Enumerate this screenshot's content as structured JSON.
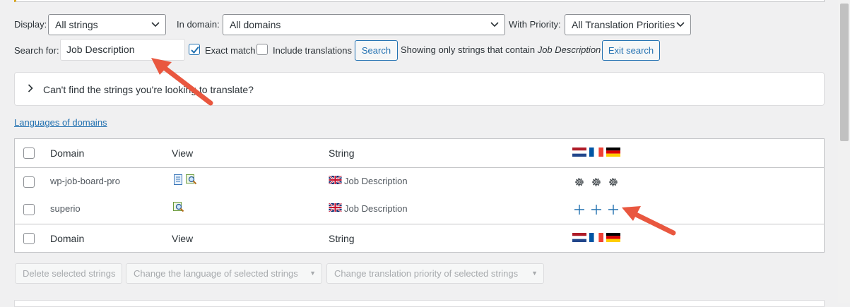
{
  "filters": {
    "display_label": "Display:",
    "display_value": "All strings",
    "domain_label": "In domain:",
    "domain_value": "All domains",
    "priority_label": "With Priority:",
    "priority_value": "All Translation Priorities",
    "search_label": "Search for:",
    "search_value": "Job Description",
    "exact_match_label": "Exact match",
    "exact_match_checked": true,
    "include_translations_label": "Include translations",
    "search_button": "Search",
    "showing_prefix": "Showing only strings that contain",
    "showing_term": "Job Description",
    "exit_search_button": "Exit search"
  },
  "help_panel": {
    "text": "Can't find the strings you're looking to translate?"
  },
  "languages_link": "Languages of domains",
  "table": {
    "columns": [
      "Domain",
      "View",
      "String"
    ],
    "flags": [
      "nl",
      "fr",
      "de"
    ],
    "rows": [
      {
        "domain": "wp-job-board-pro",
        "string": "Job Description",
        "view_icons": [
          "document-icon",
          "magnifier-icon"
        ],
        "translation_status": "gear-icon"
      },
      {
        "domain": "superio",
        "string": "Job Description",
        "view_icons": [
          "magnifier-icon"
        ],
        "translation_status": "plus-icon"
      }
    ]
  },
  "bulk_actions": {
    "delete": "Delete selected strings",
    "change_language": "Change the language of selected strings",
    "change_priority": "Change translation priority of selected strings"
  },
  "colors": {
    "accent": "#2271b1",
    "annotation_arrow": "#e9573f"
  }
}
